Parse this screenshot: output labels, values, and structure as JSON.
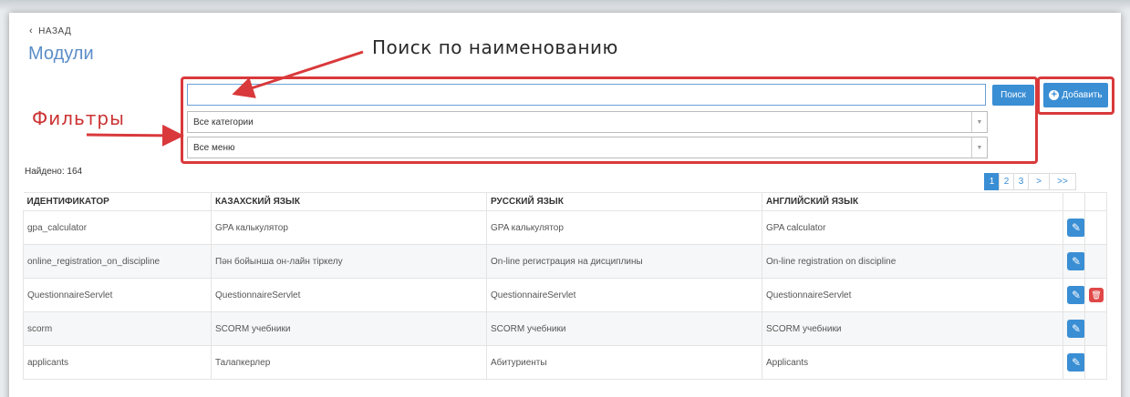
{
  "nav": {
    "back_label": "НАЗАД",
    "page_title": "Модули"
  },
  "annotations": {
    "search_callout": "Поиск по наименованию",
    "filters_callout": "Фильтры"
  },
  "search": {
    "value": "",
    "button_label": "Поиск"
  },
  "add_button_label": "Добавить",
  "filters": {
    "category": "Все категории",
    "menu": "Все меню"
  },
  "found_label": "Найдено: 164",
  "pagination": {
    "pages": [
      "1",
      "2",
      "3"
    ],
    "active": "1",
    "next": ">",
    "last": ">>"
  },
  "table": {
    "headers": [
      "ИДЕНТИФИКАТОР",
      "КАЗАХСКИЙ ЯЗЫК",
      "РУССКИЙ ЯЗЫК",
      "АНГЛИЙСКИЙ ЯЗЫК"
    ],
    "rows": [
      {
        "id": "gpa_calculator",
        "kz": "GPA калькулятор",
        "ru": "GPA калькулятор",
        "en": "GPA calculator",
        "deletable": false
      },
      {
        "id": "online_registration_on_discipline",
        "kz": "Пән бойынша он-лайн тіркелу",
        "ru": "On-line регистрация на дисциплины",
        "en": "On-line registration on discipline",
        "deletable": false
      },
      {
        "id": "QuestionnaireServlet",
        "kz": "QuestionnaireServlet",
        "ru": "QuestionnaireServlet",
        "en": "QuestionnaireServlet",
        "deletable": true
      },
      {
        "id": "scorm",
        "kz": "SCORM учебники",
        "ru": "SCORM учебники",
        "en": "SCORM учебники",
        "deletable": false
      },
      {
        "id": "applicants",
        "kz": "Талапкерлер",
        "ru": "Абитуриенты",
        "en": "Applicants",
        "deletable": false
      }
    ]
  },
  "icons": {
    "edit": "pencil-icon",
    "delete": "trash-icon",
    "back": "chevron-left-icon",
    "add": "plus-circle-icon"
  },
  "colors": {
    "primary": "#3a8ed4",
    "danger": "#e04848",
    "annotation": "#d9393b",
    "title": "#5b8dc8"
  }
}
